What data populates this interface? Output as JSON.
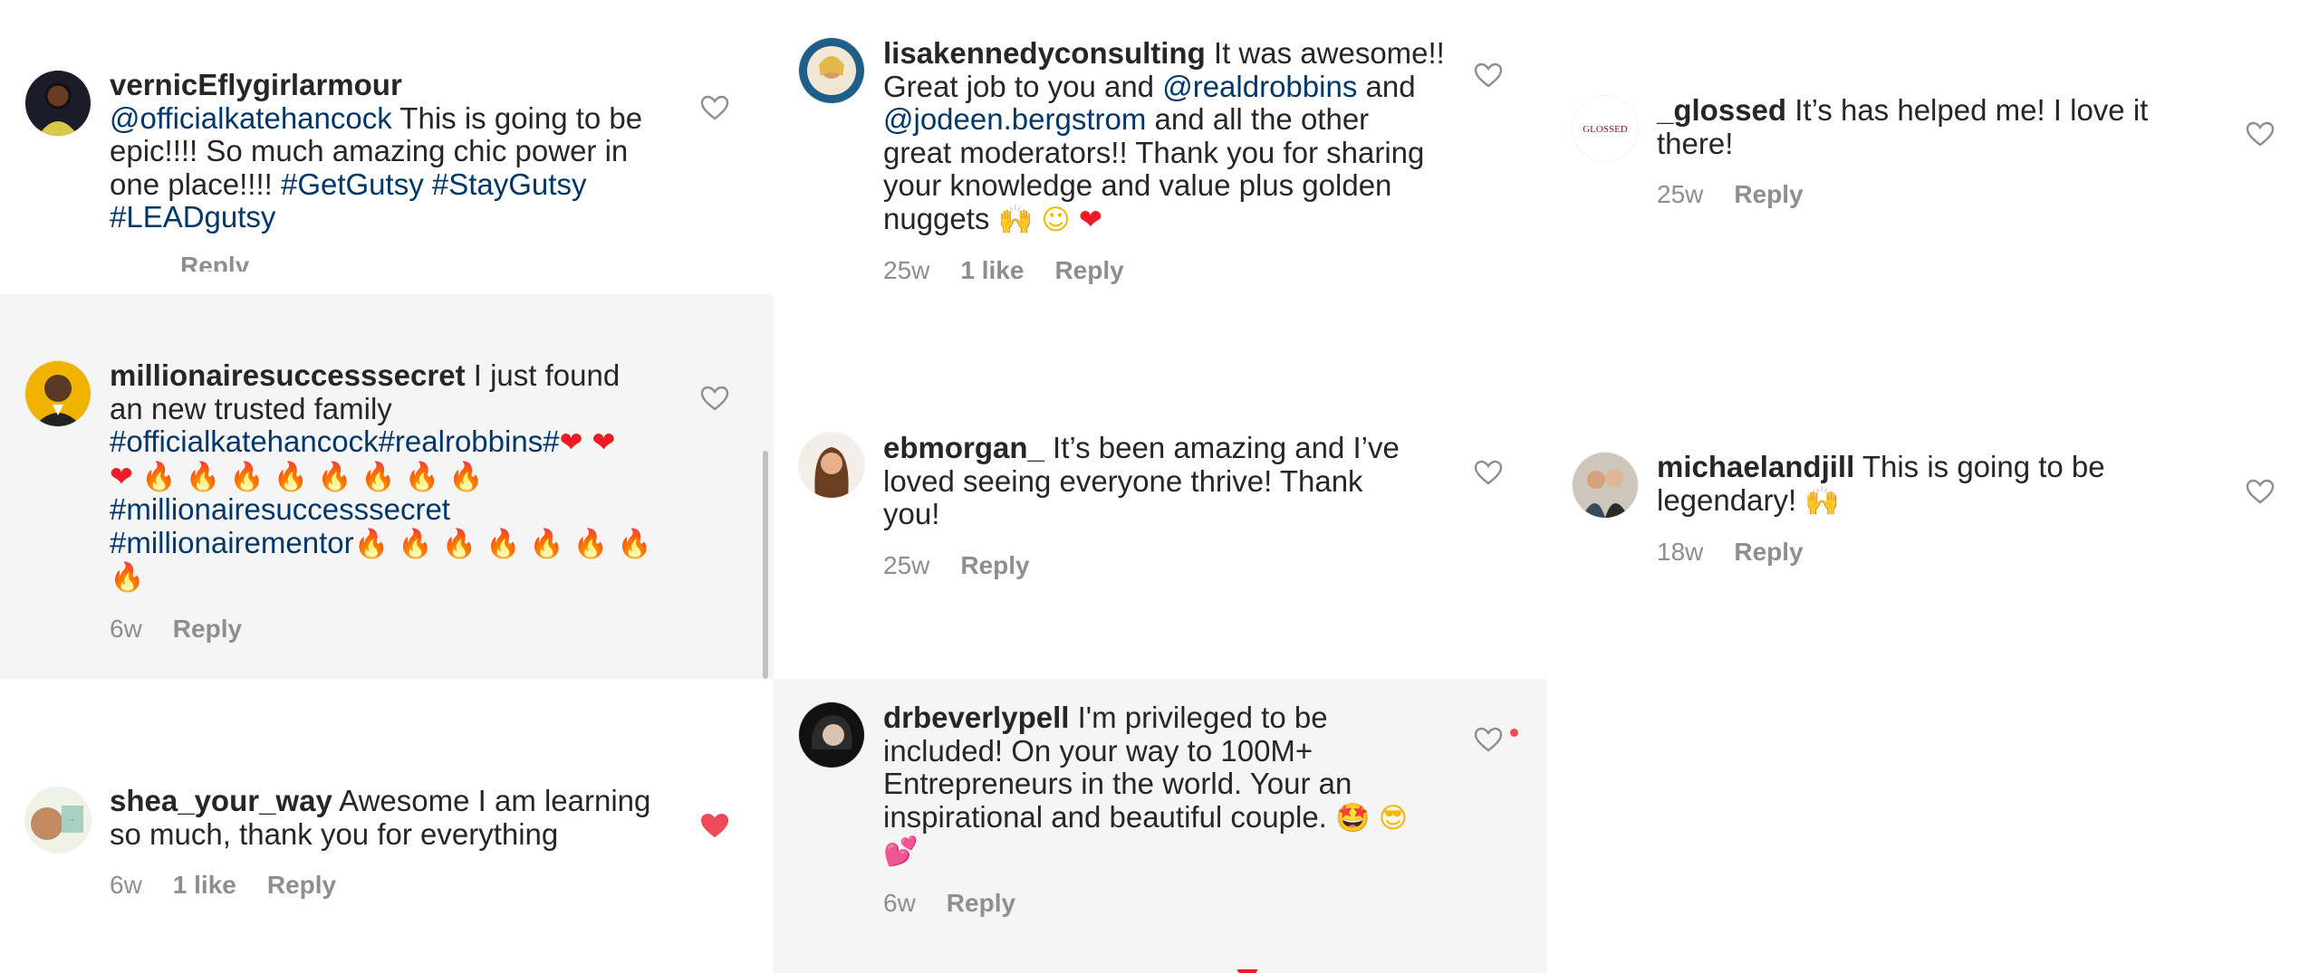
{
  "panel1": {
    "c1": {
      "username": "vernicEflygirlarmour",
      "mention": "@officialkatehancock",
      "text": " This is going to be epic!!!! So much amazing chic power in one place!!!! ",
      "tag1": "#GetGutsy",
      "tag2": "#StayGutsy",
      "tag3": "#LEADgutsy",
      "reply_label": "Reply"
    },
    "c2": {
      "username": "millionairesuccesssecret",
      "text": " I just found an new trusted family ",
      "tag1": "#officialkatehancock#realrobbins#",
      "tag2": "#millionairesuccesssecret",
      "tag3": "#millionairementor",
      "time": "6w",
      "reply_label": "Reply"
    },
    "c3": {
      "username": "shea_your_way",
      "text": " Awesome I am learning so much, thank you for everything",
      "time": "6w",
      "likes": "1 like",
      "reply_label": "Reply"
    }
  },
  "panel2": {
    "c1": {
      "username": "lisakennedyconsulting",
      "text_a": " It was awesome!! Great job to you and ",
      "mention1": "@realdrobbins",
      "text_b": " and ",
      "mention2": "@jodeen.bergstrom",
      "text_c": " and all the other great moderators!! Thank you for sharing your knowledge and value plus golden nuggets ",
      "time": "25w",
      "likes": "1 like",
      "reply_label": "Reply"
    },
    "c2": {
      "username": "ebmorgan_",
      "text": " It’s been amazing and I’ve loved seeing everyone thrive! Thank you!",
      "time": "25w",
      "reply_label": "Reply"
    },
    "c3": {
      "username": "drbeverlypell",
      "text": " I'm privileged to be included! On your way to 100M+ Entrepreneurs in the world. Your an inspirational and beautiful couple. ",
      "time": "6w",
      "reply_label": "Reply"
    }
  },
  "panel3": {
    "c1": {
      "username": "_glossed",
      "text": " It’s has helped me! I love it there!",
      "time": "25w",
      "reply_label": "Reply",
      "avatar_text": "GLOSSED"
    },
    "c2": {
      "username": "michaelandjill",
      "text": " This is going to be legendary! ",
      "time": "18w",
      "reply_label": "Reply"
    }
  },
  "icons": {
    "like": "heart-outline-icon",
    "liked": "heart-filled-icon",
    "fire": "fire-emoji",
    "red_heart": "red-heart-emoji",
    "raising_hands": "raising-hands-emoji",
    "smile": "smiling-face-emoji",
    "star_struck": "star-struck-emoji",
    "sunglasses": "sunglasses-emoji",
    "two_hearts": "two-hearts-emoji"
  },
  "colors": {
    "text": "#262626",
    "secondary": "#8e8e8e",
    "link": "#00376b",
    "like_red": "#ed4956",
    "highlight_bg": "#f5f5f5"
  }
}
